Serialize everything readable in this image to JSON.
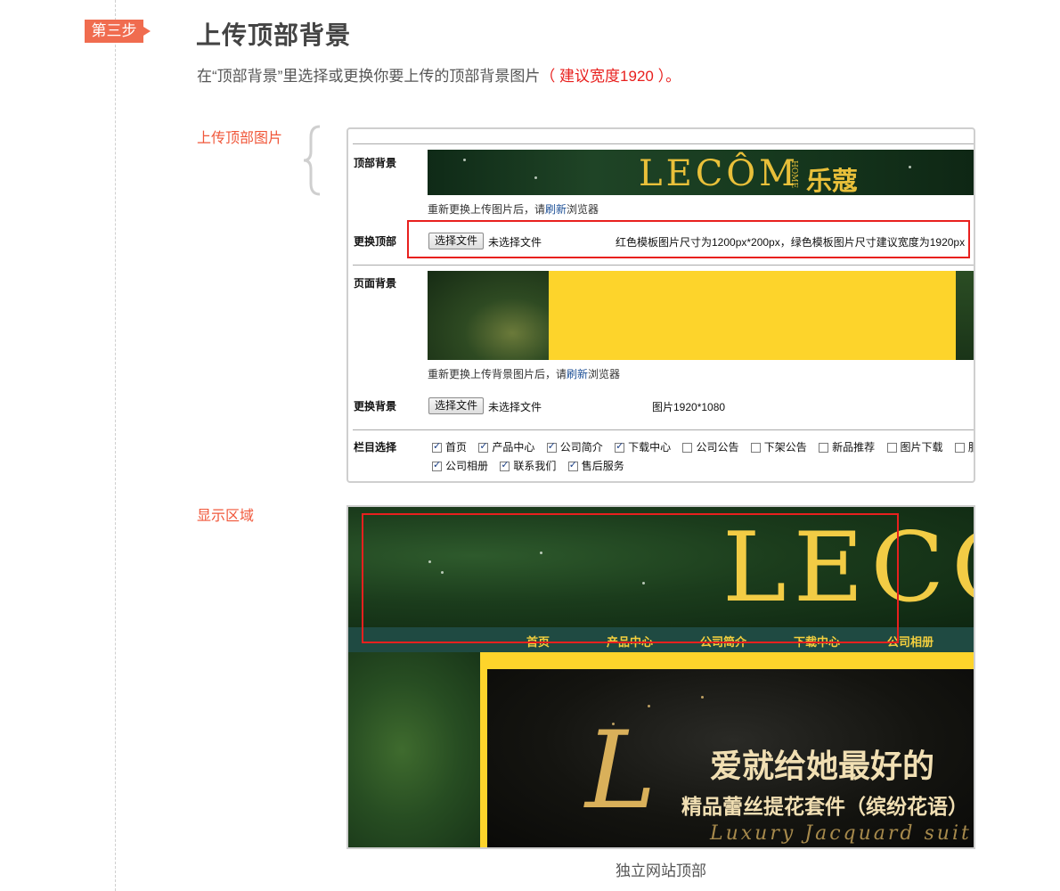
{
  "step": {
    "tag": "第三步"
  },
  "header": {
    "title": "上传顶部背景",
    "subtitle_prefix": "在“顶部背景”里选择或更换你要上传的顶部背景图片",
    "subtitle_note": "（ 建议宽度1920 ）。"
  },
  "labels": {
    "upload_top": "上传顶部图片",
    "display_area": "显示区域"
  },
  "form": {
    "top_bg_label": "顶部背景",
    "top_bg_logo": "LECÔM",
    "top_bg_home": "HOME",
    "top_bg_cn": "乐蔻",
    "top_hint_prefix": "重新更换上传图片后，请",
    "top_hint_link": "刷新",
    "top_hint_suffix": "浏览器",
    "change_top_label": "更换顶部",
    "choose_file": "选择文件",
    "no_file": "未选择文件",
    "top_size_note": "红色模板图片尺寸为1200px*200px，绿色模板图片尺寸建议宽度为1920px",
    "page_bg_label": "页面背景",
    "bg_hint_prefix": "重新更换上传背景图片后，请",
    "bg_hint_link": "刷新",
    "bg_hint_suffix": "浏览器",
    "change_bg_label": "更换背景",
    "bg_size_note": "图片1920*1080",
    "columns_label": "栏目选择",
    "columns": [
      {
        "label": "首页",
        "checked": true
      },
      {
        "label": "产品中心",
        "checked": true
      },
      {
        "label": "公司简介",
        "checked": true
      },
      {
        "label": "下载中心",
        "checked": true
      },
      {
        "label": "公司公告",
        "checked": false
      },
      {
        "label": "下架公告",
        "checked": false
      },
      {
        "label": "新品推荐",
        "checked": false
      },
      {
        "label": "图片下载",
        "checked": false
      },
      {
        "label": "服务",
        "checked": false
      },
      {
        "label": "公司相册",
        "checked": true
      },
      {
        "label": "联系我们",
        "checked": true
      },
      {
        "label": "售后服务",
        "checked": true
      }
    ]
  },
  "display": {
    "logo": "LECÔ",
    "nav": [
      "首页",
      "产品中心",
      "公司简介",
      "下载中心",
      "公司相册"
    ],
    "banner_l": "L",
    "banner_line1": "爱就给她最好的",
    "banner_line2": "精品蕾丝提花套件（缤纷花语）",
    "banner_line3": "Luxury Jacquard suit"
  },
  "caption": "独立网站顶部",
  "colors": {
    "accent_orange": "#f06c4f",
    "highlight_red": "#e8201e",
    "gold": "#f2cc45",
    "yellow": "#fdd42b",
    "nav_teal": "#1f4a42"
  }
}
